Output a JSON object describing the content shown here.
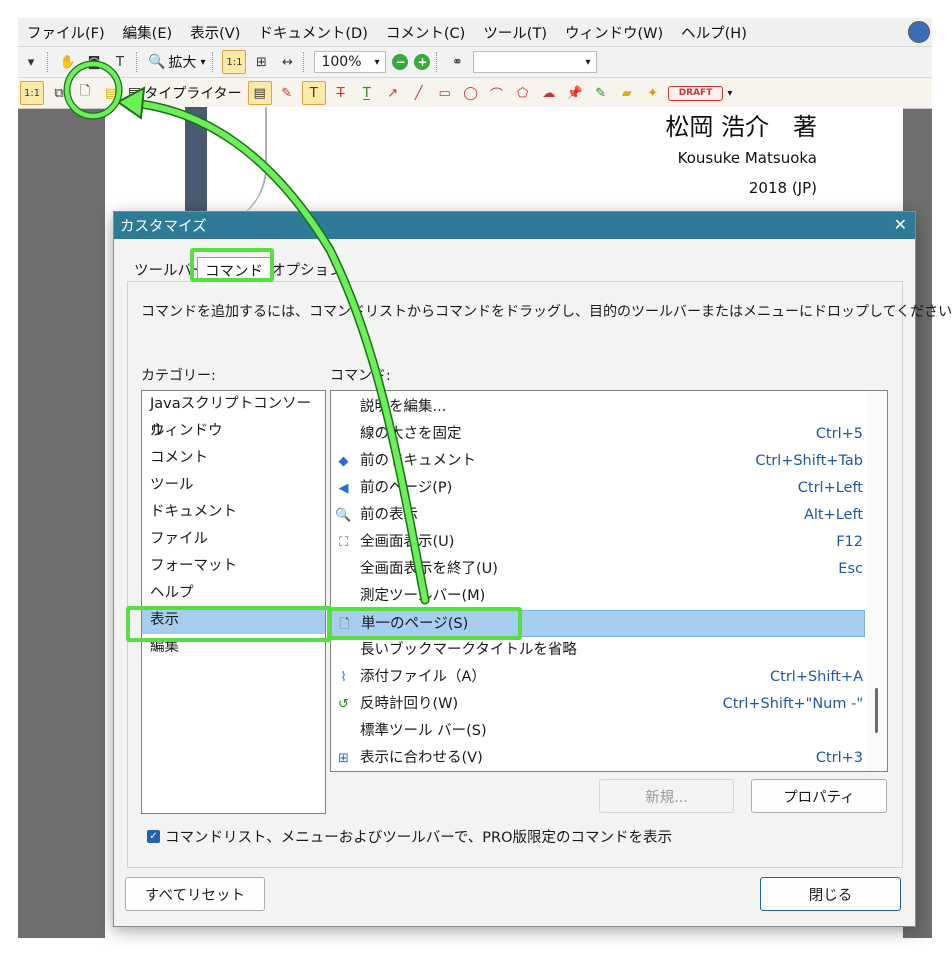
{
  "menubar": {
    "items": [
      "ファイル(F)",
      "編集(E)",
      "表示(V)",
      "ドキュメント(D)",
      "コメント(C)",
      "ツール(T)",
      "ウィンドウ(W)",
      "ヘルプ(H)"
    ]
  },
  "toolbar1": {
    "zoom_in_label": "拡大",
    "zoom_value": "100%"
  },
  "toolbar2": {
    "typewriter_label": "タイプライター",
    "draft_stamp": "DRAFT"
  },
  "document": {
    "author_ja": "松岡 浩介　著",
    "author_en": "Kousuke Matsuoka",
    "year": "2018 (JP)"
  },
  "dialog": {
    "title": "カスタマイズ",
    "close_glyph": "✕",
    "tabs": [
      "ツールバー",
      "コマンド",
      "オプション"
    ],
    "instruction": "コマンドを追加するには、コマンドリストからコマンドをドラッグし、目的のツールバーまたはメニューにドロップしてください",
    "category_label": "カテゴリー:",
    "command_label": "コマンド:",
    "categories": [
      "Javaスクリプトコンソール",
      "ウィンドウ",
      "コメント",
      "ツール",
      "ドキュメント",
      "ファイル",
      "フォーマット",
      "ヘルプ",
      "表示",
      "編集"
    ],
    "selected_category": "表示",
    "commands": [
      {
        "name": "説明を編集...",
        "shortcut": "",
        "icon": ""
      },
      {
        "name": "線の太さを固定",
        "shortcut": "Ctrl+5",
        "icon": ""
      },
      {
        "name": "前のドキュメント",
        "shortcut": "Ctrl+Shift+Tab",
        "icon": "prev-document-icon"
      },
      {
        "name": "前のページ(P)",
        "shortcut": "Ctrl+Left",
        "icon": "prev-page-icon"
      },
      {
        "name": "前の表示",
        "shortcut": "Alt+Left",
        "icon": "prev-view-icon"
      },
      {
        "name": "全画面表示(U)",
        "shortcut": "F12",
        "icon": "fullscreen-icon"
      },
      {
        "name": "全画面表示を終了(U)",
        "shortcut": "Esc",
        "icon": ""
      },
      {
        "name": "測定ツールバー(M)",
        "shortcut": "",
        "icon": ""
      },
      {
        "name": "単一のページ(S)",
        "shortcut": "",
        "icon": "single-page-icon"
      },
      {
        "name": "長いブックマークタイトルを省略",
        "shortcut": "",
        "icon": ""
      },
      {
        "name": "添付ファイル（A）",
        "shortcut": "Ctrl+Shift+A",
        "icon": "attachment-icon"
      },
      {
        "name": "反時計回り(W)",
        "shortcut": "Ctrl+Shift+\"Num -\"",
        "icon": "rotate-ccw-icon"
      },
      {
        "name": "標準ツール バー(S)",
        "shortcut": "",
        "icon": ""
      },
      {
        "name": "表示に合わせる(V)",
        "shortcut": "Ctrl+3",
        "icon": "fit-view-icon"
      }
    ],
    "selected_command": "単一のページ(S)",
    "new_button": "新規...",
    "properties_button": "プロパティ",
    "pro_checkbox_label": "コマンドリスト、メニューおよびツールバーで、PRO版限定のコマンドを表示",
    "pro_checkbox_checked": true,
    "reset_button": "すべてリセット",
    "close_button": "閉じる"
  },
  "colors": {
    "title_bar": "#2d7b96",
    "selection": "#a7cdf0",
    "highlight_annotation": "#55e040",
    "shortcut_text": "#1f57a8"
  }
}
